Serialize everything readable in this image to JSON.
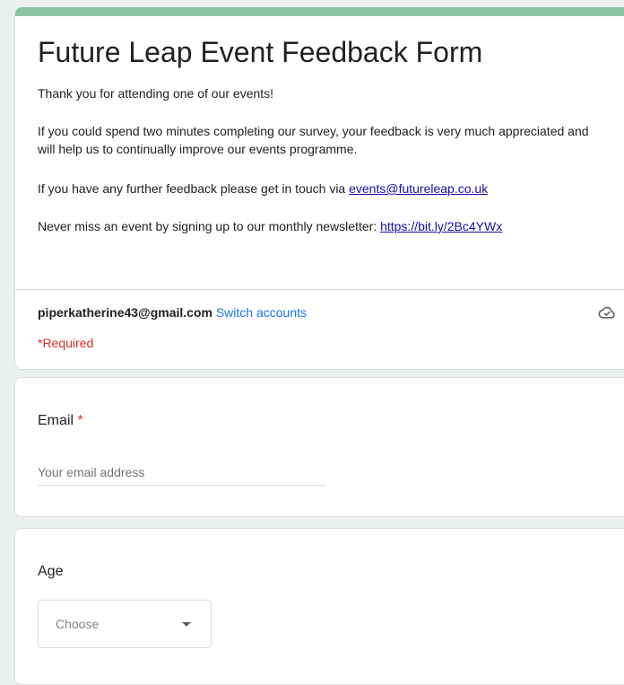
{
  "form": {
    "title": "Future Leap Event Feedback Form",
    "description": {
      "line1": "Thank you for attending one of our events!",
      "line2": "If you could spend two minutes completing our survey, your feedback is very much appreciated and will help us to continually improve our events programme.",
      "line3_text": "If you have any further feedback please get in touch via ",
      "line3_link": "events@futureleap.co.uk",
      "line4_text": "Never miss an event by signing up to our monthly newsletter: ",
      "line4_link": "https://bit.ly/2Bc4YWx"
    },
    "account": {
      "email": "piperkatherine43@gmail.com",
      "switch_label": "Switch accounts"
    },
    "required_note": "*Required"
  },
  "questions": {
    "email": {
      "title": "Email",
      "required_mark": "*",
      "placeholder": "Your email address"
    },
    "age": {
      "title": "Age",
      "select_value": "Choose"
    }
  },
  "icons": {
    "cloud": "cloud-saved-icon",
    "caret": "caret-down-icon"
  },
  "colors": {
    "accent": "#8dc5a4",
    "link": "#1a73e8",
    "required": "#d93025",
    "background": "#ebf0ee"
  }
}
